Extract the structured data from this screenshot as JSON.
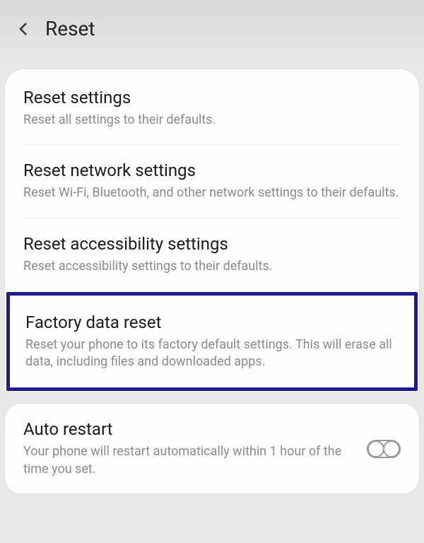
{
  "header": {
    "title": "Reset"
  },
  "items": [
    {
      "title": "Reset settings",
      "desc": "Reset all settings to their defaults."
    },
    {
      "title": "Reset network settings",
      "desc": "Reset Wi-Fi, Bluetooth, and other network settings to their defaults."
    },
    {
      "title": "Reset accessibility settings",
      "desc": "Reset accessibility settings to their defaults."
    },
    {
      "title": "Factory data reset",
      "desc": "Reset your phone to its factory default settings. This will erase all data, including files and downloaded apps."
    }
  ],
  "auto_restart": {
    "title": "Auto restart",
    "desc": "Your phone will restart automatically within 1 hour of the time you set.",
    "enabled": false
  }
}
